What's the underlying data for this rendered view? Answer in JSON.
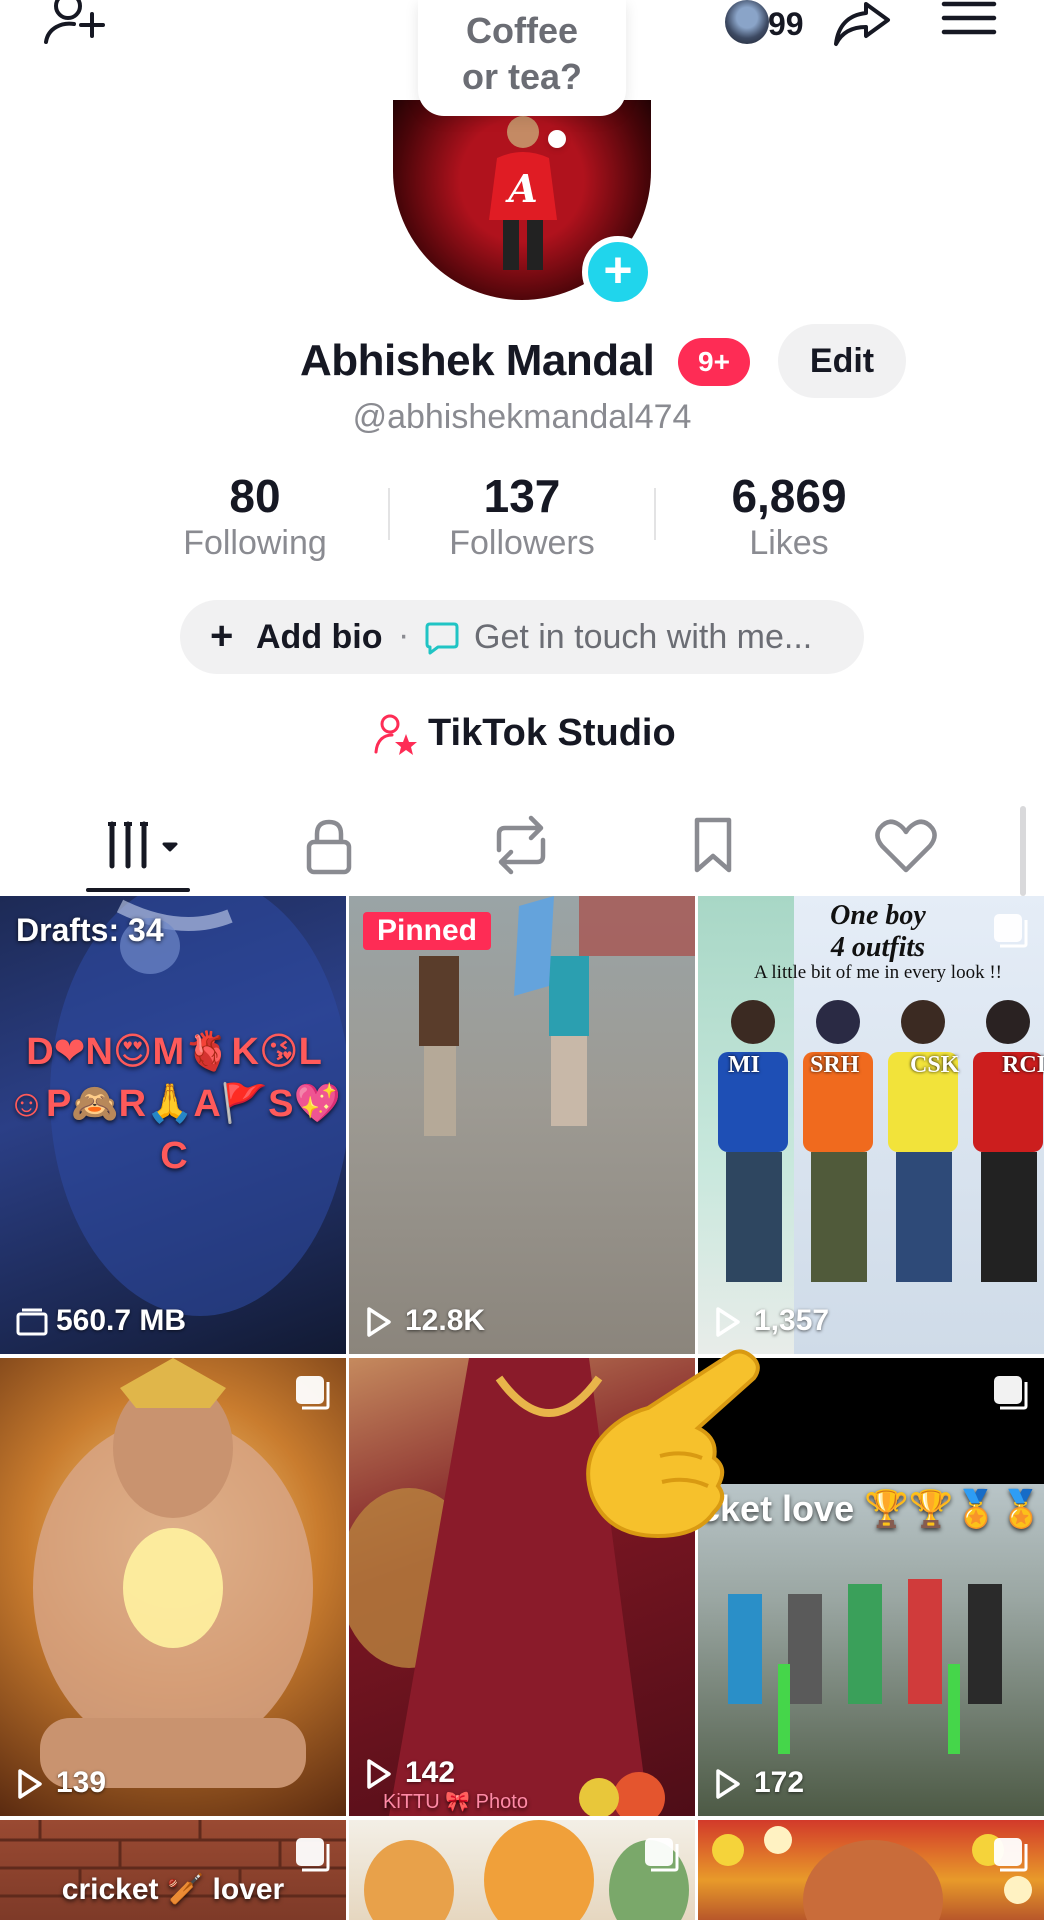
{
  "header": {
    "mini_count": "99"
  },
  "profile": {
    "bubble_text": "Coffee or tea?",
    "name": "Abhishek Mandal",
    "notification_badge": "9+",
    "edit_label": "Edit",
    "handle": "@abhishekmandal474"
  },
  "stats": [
    {
      "value": "80",
      "label": "Following"
    },
    {
      "value": "137",
      "label": "Followers"
    },
    {
      "value": "6,869",
      "label": "Likes"
    }
  ],
  "bio": {
    "add_bio_label": "Add bio",
    "separator": "·",
    "get_in_touch": "Get in touch with me..."
  },
  "studio": {
    "label": "TikTok Studio"
  },
  "tabs": [
    "videos",
    "private",
    "reposts",
    "favorites",
    "liked"
  ],
  "grid": {
    "tiles": [
      {
        "badge": "Drafts: 34",
        "caption": "D❤N😍M🫀K😘L ☺P🙈R🙏A🚩S💖 C",
        "stat": "560.7 MB"
      },
      {
        "badge": "Pinned",
        "stat": "12.8K"
      },
      {
        "title_line1": "One boy",
        "title_line2": "4 outfits",
        "subtitle": "A little bit of me in every look !!",
        "labels": [
          "MI",
          "SRH",
          "CSK",
          "RCI"
        ],
        "stat": "1,357"
      },
      {
        "stat": "139"
      },
      {
        "stat": "142",
        "footer": "KiTTU 🎀  Photo"
      },
      {
        "caption": "cket love 🏆🏆🏅🏅",
        "stat": "172"
      },
      {
        "caption": "cricket 🏏 lover"
      },
      {},
      {}
    ]
  },
  "colors": {
    "accent_pink": "#fe2c55",
    "accent_cyan": "#20d5ec",
    "text_primary": "#161823",
    "text_secondary": "#8a8b91",
    "pill_bg": "#f1f1f2"
  }
}
